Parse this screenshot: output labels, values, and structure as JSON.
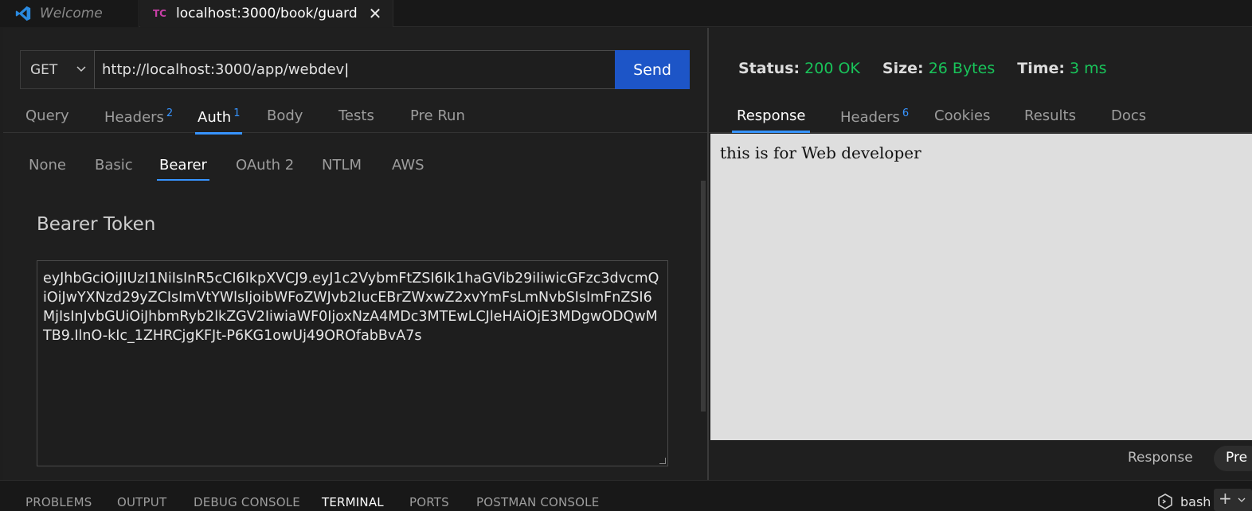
{
  "tabs": {
    "welcome": "Welcome",
    "guard_badge": "TC",
    "guard": "localhost:3000/book/guard"
  },
  "request": {
    "method": "GET",
    "url": "http://localhost:3000/app/webdev",
    "send_label": "Send"
  },
  "request_tabs": [
    {
      "label": "Query",
      "count": ""
    },
    {
      "label": "Headers",
      "count": "2"
    },
    {
      "label": "Auth",
      "count": "1"
    },
    {
      "label": "Body",
      "count": ""
    },
    {
      "label": "Tests",
      "count": ""
    },
    {
      "label": "Pre Run",
      "count": ""
    }
  ],
  "auth_tabs": [
    "None",
    "Basic",
    "Bearer",
    "OAuth 2",
    "NTLM",
    "AWS"
  ],
  "bearer": {
    "title": "Bearer Token",
    "token": "eyJhbGciOiJIUzI1NiIsInR5cCI6IkpXVCJ9.eyJ1c2VybmFtZSI6Ik1haGVib29iIiwicGFzc3dvcmQiOiJwYXNzd29yZCIsImVtYWlsIjoibWFoZWJvb2IucEBrZWxwZ2xvYmFsLmNvbSIsImFnZSI6MjIsInJvbGUiOiJhbmRyb2lkZGV2IiwiaWF0IjoxNzA4MDc3MTEwLCJleHAiOjE3MDgwODQwMTB9.IlnO-kIc_1ZHRCjgKFJt-P6KG1owUj49OROfabBvA7s"
  },
  "response": {
    "status_label": "Status:",
    "status_value": "200 OK",
    "size_label": "Size:",
    "size_value": "26 Bytes",
    "time_label": "Time:",
    "time_value": "3 ms",
    "body": "this is for Web developer",
    "footer_response": "Response",
    "footer_pre": "Pre"
  },
  "response_tabs": [
    {
      "label": "Response",
      "count": ""
    },
    {
      "label": "Headers",
      "count": "6"
    },
    {
      "label": "Cookies",
      "count": ""
    },
    {
      "label": "Results",
      "count": ""
    },
    {
      "label": "Docs",
      "count": ""
    }
  ],
  "panel_tabs": [
    "PROBLEMS",
    "OUTPUT",
    "DEBUG CONSOLE",
    "TERMINAL",
    "PORTS",
    "POSTMAN CONSOLE"
  ],
  "terminal": {
    "shell": "bash",
    "add": "+"
  },
  "colors": {
    "accent": "#3794ff",
    "send": "#1d55c7",
    "status_ok": "#19c45a"
  }
}
